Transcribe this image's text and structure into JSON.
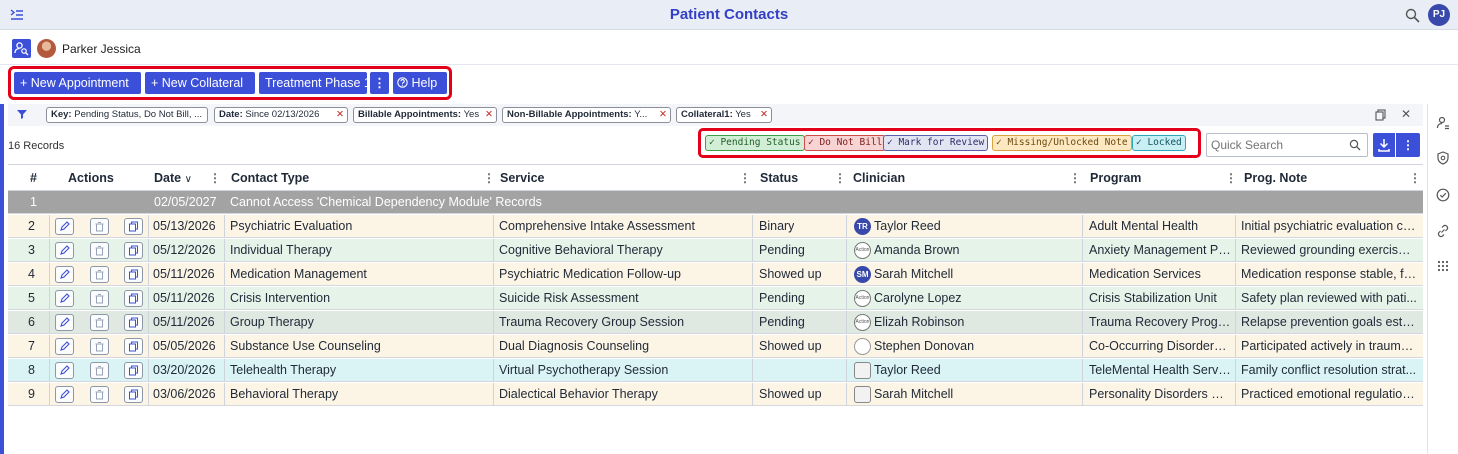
{
  "app": {
    "title": "Patient Contacts",
    "user_initials": "PJ"
  },
  "patient": {
    "name": "Parker Jessica"
  },
  "actions": {
    "new_appointment": "+ New Appointment",
    "new_collateral": "+ New Collateral",
    "treatment_phase": "Treatment Phase 1",
    "more": "⋮",
    "help": "Help"
  },
  "filters": [
    {
      "key": "Key:",
      "value": " Pending Status, Do Not Bill, ..."
    },
    {
      "key": "Date:",
      "value": " Since 02/13/2026"
    },
    {
      "key": "Billable Appointments:",
      "value": " Yes"
    },
    {
      "key": "Non-Billable Appointments:",
      "value": " Y..."
    },
    {
      "key": "Collateral1:",
      "value": " Yes"
    }
  ],
  "records_label": "16 Records",
  "legend": [
    {
      "label": "✓ Pending Status",
      "bg": "#d3eed6",
      "border": "#3aa14a",
      "color": "#1f5f29"
    },
    {
      "label": "✓ Do Not Bill",
      "bg": "#f8d3d3",
      "border": "#d14b4b",
      "color": "#7a1d1d"
    },
    {
      "label": "✓ Mark for Review",
      "bg": "#e3e4f2",
      "border": "#5b5fa8",
      "color": "#2b2d6a"
    },
    {
      "label": "✓ Missing/Unlocked Note",
      "bg": "#fde8c2",
      "border": "#d8a33b",
      "color": "#6a4b0f"
    },
    {
      "label": "✓ Locked",
      "bg": "#c9eef4",
      "border": "#2aa9bd",
      "color": "#0e5663"
    }
  ],
  "search": {
    "placeholder": "Quick Search"
  },
  "columns": {
    "num": "#",
    "actions": "Actions",
    "date": "Date",
    "contact_type": "Contact Type",
    "service": "Service",
    "status": "Status",
    "clinician": "Clinician",
    "program": "Program",
    "note": "Prog. Note"
  },
  "group_row": {
    "num": "1",
    "date": "02/05/2027",
    "text": "Cannot Access 'Chemical Dependency Module' Records"
  },
  "rows": [
    {
      "num": "2",
      "date": "05/13/2026",
      "contact_type": "Psychiatric Evaluation",
      "service": "Comprehensive Intake Assessment",
      "status": "Binary",
      "clinician": "Taylor Reed",
      "avatar": "TR",
      "program": "Adult Mental Health",
      "note": "Initial psychiatric evaluation co...",
      "bg": "#fcf4e5"
    },
    {
      "num": "3",
      "date": "05/12/2026",
      "contact_type": "Individual Therapy",
      "service": "Cognitive Behavioral Therapy",
      "status": "Pending",
      "clinician": "Amanda Brown",
      "avatar": "Action",
      "program": "Anxiety Management Program",
      "note": "Reviewed grounding exercises ...",
      "bg": "#e6f3e9"
    },
    {
      "num": "4",
      "date": "05/11/2026",
      "contact_type": "Medication Management",
      "service": "Psychiatric Medication Follow-up",
      "status": "Showed up",
      "clinician": "Sarah Mitchell",
      "avatar": "SM",
      "program": "Medication Services",
      "note": "Medication response stable, fo...",
      "bg": "#fcf4e5"
    },
    {
      "num": "5",
      "date": "05/11/2026",
      "contact_type": "Crisis Intervention",
      "service": "Suicide Risk Assessment",
      "status": "Pending",
      "clinician": "Carolyne Lopez",
      "avatar": "Action",
      "program": "Crisis Stabilization Unit",
      "note": "Safety plan reviewed with pati...",
      "bg": "#e6f3e9"
    },
    {
      "num": "6",
      "date": "05/11/2026",
      "contact_type": "Group Therapy",
      "service": "Trauma Recovery Group Session",
      "status": "Pending",
      "clinician": "Elizah Robinson",
      "avatar": "Action",
      "program": "Trauma Recovery Program",
      "note": "Relapse prevention goals esta...",
      "bg": "#dfe8e1"
    },
    {
      "num": "7",
      "date": "05/05/2026",
      "contact_type": "Substance Use Counseling",
      "service": "Dual Diagnosis Counseling",
      "status": "Showed up",
      "clinician": "Stephen Donovan",
      "avatar": "",
      "program": "Co-Occurring Disorders Progra...",
      "note": "Participated actively in trauma ...",
      "bg": "#fcf4e5"
    },
    {
      "num": "8",
      "date": "03/20/2026",
      "contact_type": "Telehealth Therapy",
      "service": "Virtual Psychotherapy Session",
      "status": "",
      "clinician": "Taylor Reed",
      "avatar": "img",
      "program": "TeleMental Health Services",
      "note": "Family conflict resolution strat...",
      "bg": "#daf4f6"
    },
    {
      "num": "9",
      "date": "03/06/2026",
      "contact_type": "Behavioral Therapy",
      "service": "Dialectical Behavior Therapy",
      "status": "Showed up",
      "clinician": "Sarah Mitchell",
      "avatar": "img",
      "program": "Personality Disorders Program",
      "note": "Practiced emotional regulation ...",
      "bg": "#fcf4e5"
    }
  ],
  "colors": {
    "accent": "#3b4fd8",
    "highlight": "#e3001b",
    "group_row": "#a3a3a3"
  }
}
